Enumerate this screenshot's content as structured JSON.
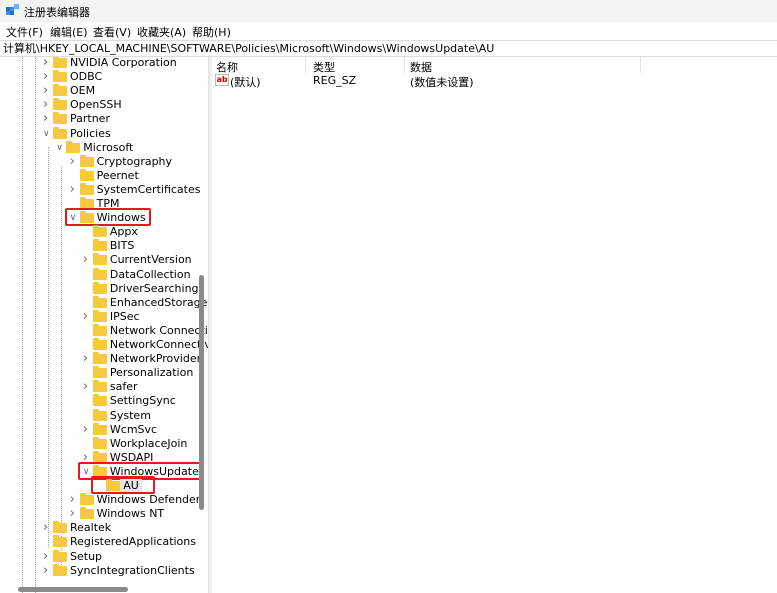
{
  "window": {
    "title": "注册表编辑器",
    "icon": "regedit-icon"
  },
  "menu": [
    "文件(F)",
    "编辑(E)",
    "查看(V)",
    "收藏夹(A)",
    "帮助(H)"
  ],
  "address": "计算机\\HKEY_LOCAL_MACHINE\\SOFTWARE\\Policies\\Microsoft\\Windows\\WindowsUpdate\\AU",
  "tree": [
    {
      "label": "NVIDIA Corporation",
      "level": 3,
      "state": "collapsed"
    },
    {
      "label": "ODBC",
      "level": 3,
      "state": "collapsed"
    },
    {
      "label": "OEM",
      "level": 3,
      "state": "collapsed"
    },
    {
      "label": "OpenSSH",
      "level": 3,
      "state": "collapsed"
    },
    {
      "label": "Partner",
      "level": 3,
      "state": "collapsed"
    },
    {
      "label": "Policies",
      "level": 3,
      "state": "expanded"
    },
    {
      "label": "Microsoft",
      "level": 4,
      "state": "expanded"
    },
    {
      "label": "Cryptography",
      "level": 5,
      "state": "collapsed"
    },
    {
      "label": "Peernet",
      "level": 5,
      "state": "leaf"
    },
    {
      "label": "SystemCertificates",
      "level": 5,
      "state": "collapsed"
    },
    {
      "label": "TPM",
      "level": 5,
      "state": "leaf"
    },
    {
      "label": "Windows",
      "level": 5,
      "state": "expanded",
      "highlight": true
    },
    {
      "label": "Appx",
      "level": 6,
      "state": "leaf"
    },
    {
      "label": "BITS",
      "level": 6,
      "state": "leaf"
    },
    {
      "label": "CurrentVersion",
      "level": 6,
      "state": "collapsed"
    },
    {
      "label": "DataCollection",
      "level": 6,
      "state": "leaf"
    },
    {
      "label": "DriverSearching",
      "level": 6,
      "state": "leaf"
    },
    {
      "label": "EnhancedStorageI",
      "level": 6,
      "state": "leaf"
    },
    {
      "label": "IPSec",
      "level": 6,
      "state": "collapsed"
    },
    {
      "label": "Network Connecti",
      "level": 6,
      "state": "leaf"
    },
    {
      "label": "NetworkConnectiv",
      "level": 6,
      "state": "leaf"
    },
    {
      "label": "NetworkProvider",
      "level": 6,
      "state": "collapsed"
    },
    {
      "label": "Personalization",
      "level": 6,
      "state": "leaf"
    },
    {
      "label": "safer",
      "level": 6,
      "state": "collapsed"
    },
    {
      "label": "SettingSync",
      "level": 6,
      "state": "leaf"
    },
    {
      "label": "System",
      "level": 6,
      "state": "leaf"
    },
    {
      "label": "WcmSvc",
      "level": 6,
      "state": "collapsed"
    },
    {
      "label": "WorkplaceJoin",
      "level": 6,
      "state": "leaf"
    },
    {
      "label": "WSDAPI",
      "level": 6,
      "state": "collapsed"
    },
    {
      "label": "WindowsUpdate",
      "level": 6,
      "state": "expanded",
      "highlight": true
    },
    {
      "label": "AU",
      "level": 7,
      "state": "leaf",
      "selected": true,
      "highlight": true
    },
    {
      "label": "Windows Defender",
      "level": 5,
      "state": "collapsed"
    },
    {
      "label": "Windows NT",
      "level": 5,
      "state": "collapsed"
    },
    {
      "label": "Realtek",
      "level": 3,
      "state": "collapsed"
    },
    {
      "label": "RegisteredApplications",
      "level": 3,
      "state": "leaf"
    },
    {
      "label": "Setup",
      "level": 3,
      "state": "collapsed"
    },
    {
      "label": "SyncIntegrationClients",
      "level": 3,
      "state": "collapsed"
    }
  ],
  "values": {
    "headers": [
      "名称",
      "类型",
      "数据"
    ],
    "rows": [
      {
        "name": "(默认)",
        "type": "REG_SZ",
        "data": "(数值未设置)",
        "icon": "string-value-icon"
      }
    ]
  },
  "colors": {
    "highlight": "#e8191c",
    "folder": "#f8c93f"
  }
}
